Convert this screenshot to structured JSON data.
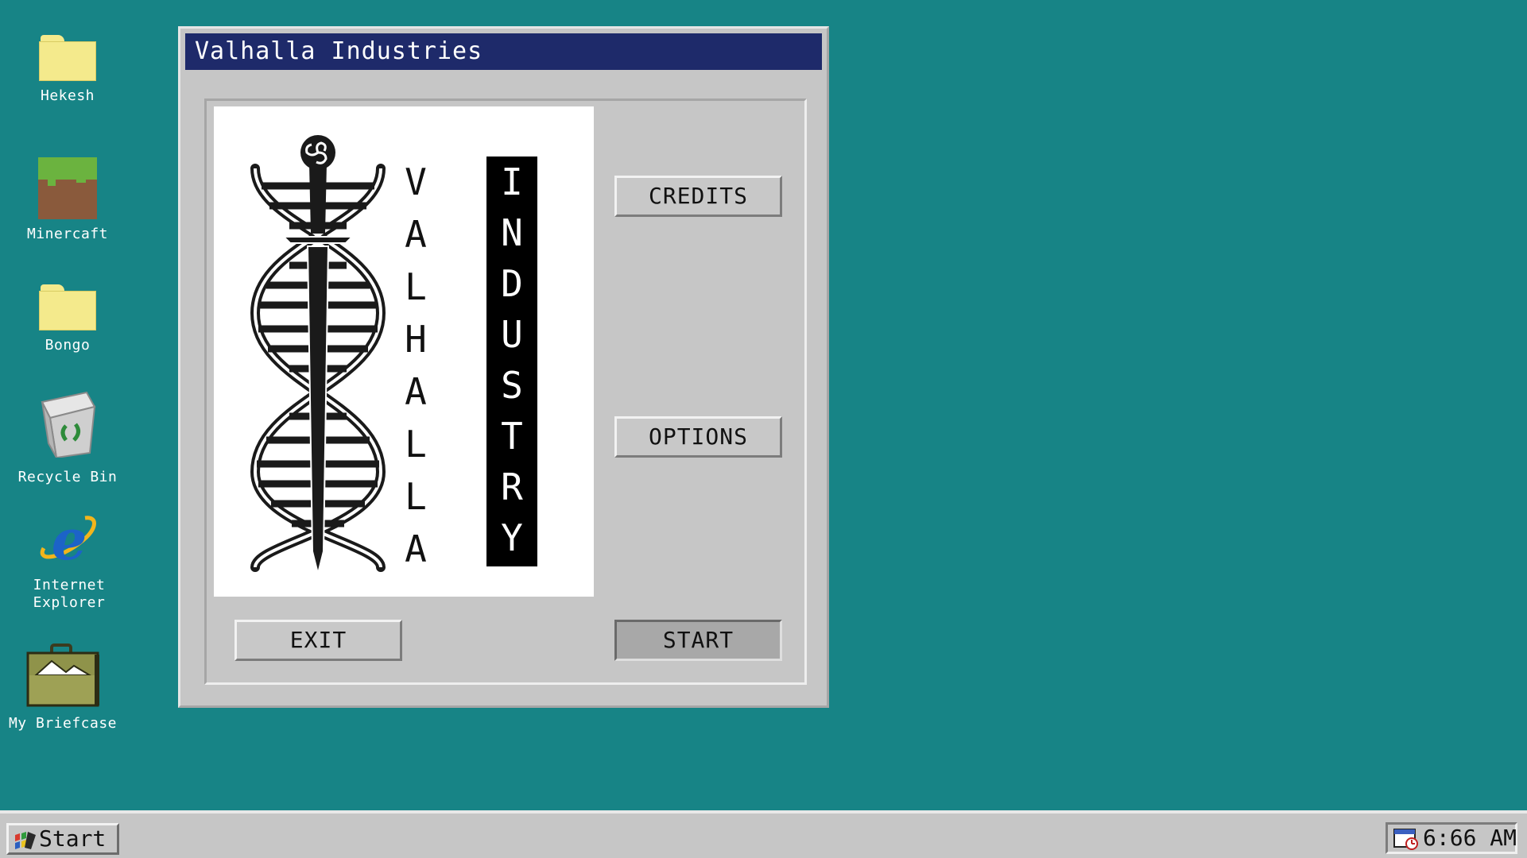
{
  "desktop": {
    "background_color": "#178486",
    "icons": [
      {
        "label": "Hekesh",
        "icon": "folder-icon"
      },
      {
        "label": "Minercaft",
        "icon": "grass-block-icon"
      },
      {
        "label": "Bongo",
        "icon": "folder-icon"
      },
      {
        "label": "Recycle Bin",
        "icon": "recycle-bin-icon"
      },
      {
        "label": "Internet\nExplorer",
        "icon": "internet-explorer-icon"
      },
      {
        "label": "My Briefcase",
        "icon": "briefcase-icon"
      }
    ]
  },
  "window": {
    "title": "Valhalla Industries",
    "title_bar_color": "#1e2a6a",
    "logo": {
      "icon": "dna-sword-triskelion-logo",
      "left_column": "VALHALLA",
      "right_column": "INDUSTRY"
    },
    "buttons": {
      "credits": "CREDITS",
      "options": "OPTIONS",
      "exit": "EXIT",
      "start": "START"
    }
  },
  "taskbar": {
    "start_label": "Start",
    "clock": "6:66 AM"
  }
}
